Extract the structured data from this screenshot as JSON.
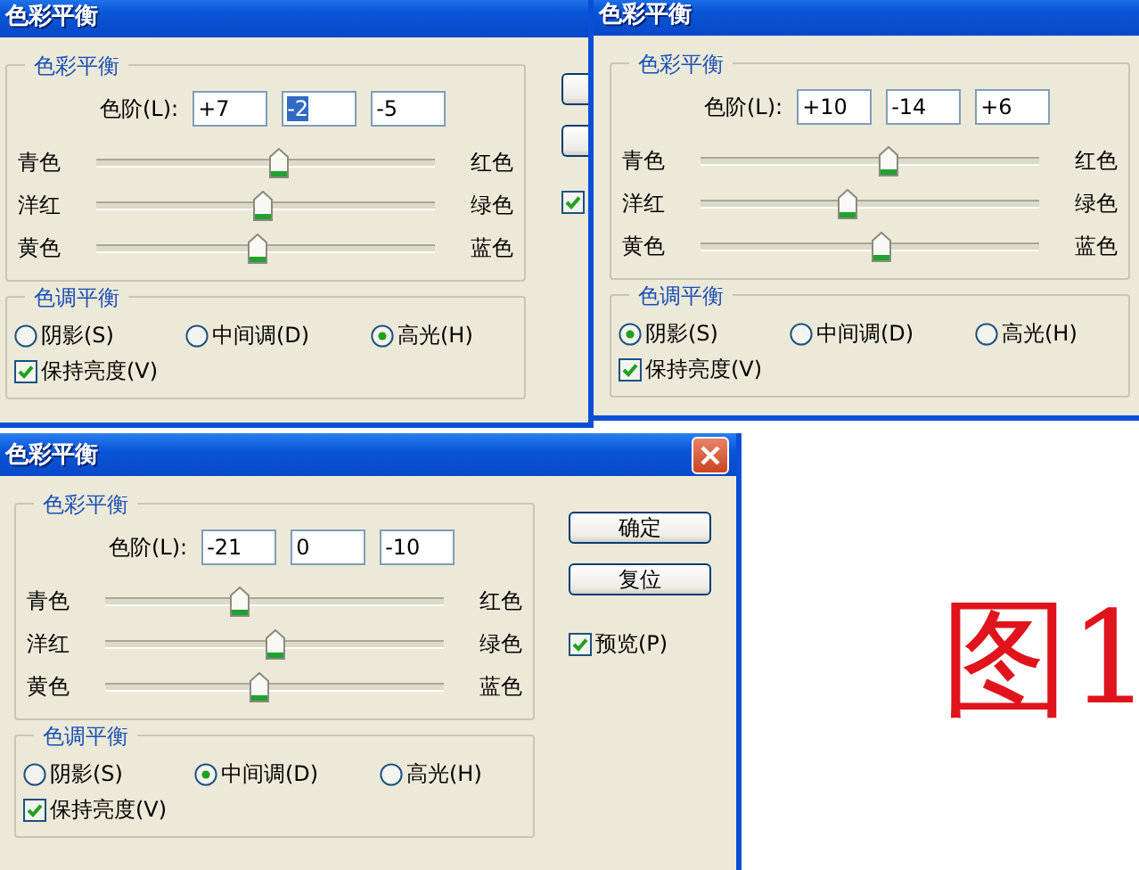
{
  "dialogs": [
    {
      "title": "色彩平衡",
      "close_button": false,
      "color_group": {
        "legend": "色彩平衡",
        "levels_label": "色阶(L):",
        "levels": [
          {
            "value": "+7",
            "selected": false
          },
          {
            "value": "-2",
            "selected": true
          },
          {
            "value": "-5",
            "selected": false
          }
        ],
        "sliders": [
          {
            "left": "青色",
            "right": "红色",
            "level": 0.535
          },
          {
            "left": "洋红",
            "right": "绿色",
            "level": 0.49
          },
          {
            "left": "黄色",
            "right": "蓝色",
            "level": 0.475
          }
        ]
      },
      "tone_group": {
        "legend": "色调平衡",
        "options": [
          {
            "label": "阴影(S)",
            "selected": false
          },
          {
            "label": "中间调(D)",
            "selected": false
          },
          {
            "label": "高光(H)",
            "selected": true
          }
        ],
        "preserve": {
          "label": "保持亮度(V)",
          "checked": true
        }
      },
      "buttons": [
        {
          "kind": "stub"
        },
        {
          "kind": "stub"
        }
      ],
      "preview": {
        "checked": true
      }
    },
    {
      "title": "色彩平衡",
      "close_button": false,
      "color_group": {
        "legend": "色彩平衡",
        "levels_label": "色阶(L):",
        "levels": [
          {
            "value": "+10",
            "selected": false
          },
          {
            "value": "-14",
            "selected": false
          },
          {
            "value": "+6",
            "selected": false
          }
        ],
        "sliders": [
          {
            "left": "青色",
            "right": "红色",
            "level": 0.55
          },
          {
            "left": "洋红",
            "right": "绿色",
            "level": 0.43
          },
          {
            "left": "黄色",
            "right": "蓝色",
            "level": 0.53
          }
        ]
      },
      "tone_group": {
        "legend": "色调平衡",
        "options": [
          {
            "label": "阴影(S)",
            "selected": true
          },
          {
            "label": "中间调(D)",
            "selected": false
          },
          {
            "label": "高光(H)",
            "selected": false
          }
        ],
        "preserve": {
          "label": "保持亮度(V)",
          "checked": true
        }
      }
    },
    {
      "title": "色彩平衡",
      "close_button": true,
      "color_group": {
        "legend": "色彩平衡",
        "levels_label": "色阶(L):",
        "levels": [
          {
            "value": "-21",
            "selected": false
          },
          {
            "value": "0",
            "selected": false
          },
          {
            "value": "-10",
            "selected": false
          }
        ],
        "sliders": [
          {
            "left": "青色",
            "right": "红色",
            "level": 0.395
          },
          {
            "left": "洋红",
            "right": "绿色",
            "level": 0.5
          },
          {
            "left": "黄色",
            "right": "蓝色",
            "level": 0.45
          }
        ]
      },
      "tone_group": {
        "legend": "色调平衡",
        "options": [
          {
            "label": "阴影(S)",
            "selected": false
          },
          {
            "label": "中间调(D)",
            "selected": true
          },
          {
            "label": "高光(H)",
            "selected": false
          }
        ],
        "preserve": {
          "label": "保持亮度(V)",
          "checked": true
        }
      },
      "buttons": [
        {
          "kind": "full",
          "label": "确定"
        },
        {
          "kind": "full",
          "label": "复位"
        }
      ],
      "preview": {
        "label": "预览(P)",
        "checked": true
      }
    }
  ],
  "figure_label": "图1"
}
